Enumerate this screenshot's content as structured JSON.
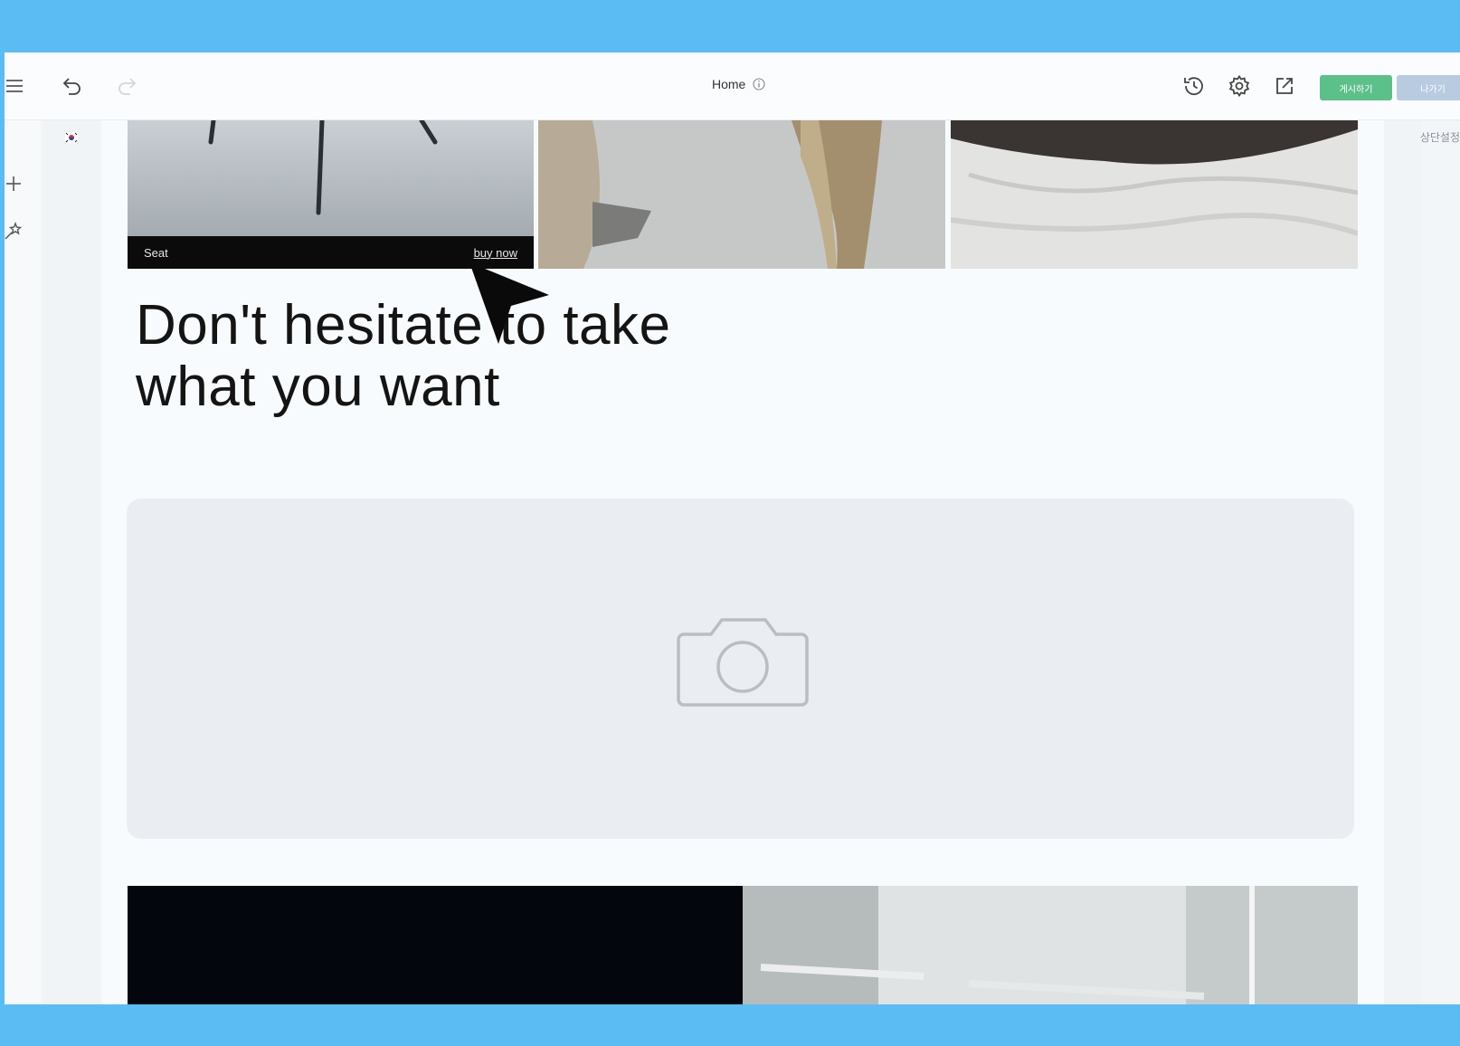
{
  "toolbar": {
    "page_title": "Home",
    "publish_label": "게시하기",
    "exit_label": "나가기",
    "publish_color": "#5cc08a",
    "exit_color": "#b8cbe0"
  },
  "right_panel": {
    "label": "상단설정"
  },
  "left_rail": {
    "icons": [
      "menu-icon",
      "plus-icon",
      "magic-icon"
    ]
  },
  "gallery": {
    "tiles": [
      {
        "caption": "Seat",
        "link": "buy now"
      },
      {
        "caption": "",
        "link": ""
      },
      {
        "caption": "",
        "link": ""
      }
    ]
  },
  "hero": {
    "heading_line1": "Don't hesitate to take",
    "heading_line2": "what you want"
  },
  "image_placeholder": {
    "icon": "camera-icon"
  },
  "colors": {
    "frame": "#5bbcf4",
    "canvas": "#f8fbfd",
    "placeholder": "#eaeef2"
  }
}
